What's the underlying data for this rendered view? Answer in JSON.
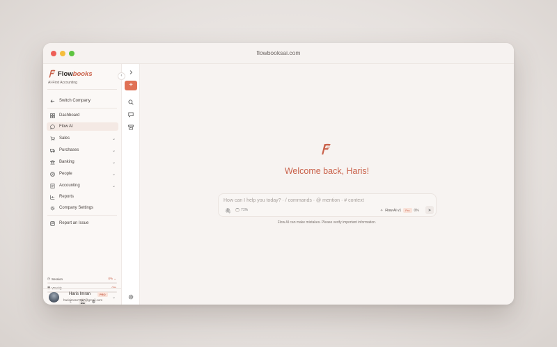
{
  "window": {
    "url": "flowbooksai.com"
  },
  "brand": {
    "name_plain": "Flow",
    "name_italic": "books",
    "tagline": "AI-First Accounting"
  },
  "sidebar": {
    "switch_company": "Switch Company",
    "items": [
      {
        "label": "Dashboard",
        "icon": "dashboard-icon"
      },
      {
        "label": "Flow AI",
        "icon": "chat-icon",
        "active": true
      },
      {
        "label": "Sales",
        "icon": "cart-icon",
        "expandable": true
      },
      {
        "label": "Purchases",
        "icon": "truck-icon",
        "expandable": true
      },
      {
        "label": "Banking",
        "icon": "bank-icon",
        "expandable": true
      },
      {
        "label": "People",
        "icon": "user-circle-icon",
        "expandable": true
      },
      {
        "label": "Accounting",
        "icon": "ledger-icon",
        "expandable": true
      },
      {
        "label": "Reports",
        "icon": "chart-icon"
      },
      {
        "label": "Company Settings",
        "icon": "gear-icon"
      }
    ],
    "report_issue": "Report an Issue",
    "usage": {
      "session": {
        "label": "Session",
        "value": "0%",
        "fill": 0
      },
      "weekly": {
        "label": "Weekly",
        "value": "0%",
        "fill": 0
      }
    }
  },
  "user": {
    "name": "Haris Imran",
    "badge": "PRO",
    "email": "harisimran7657@gmail.com"
  },
  "main": {
    "welcome": "Welcome back, Haris!",
    "chat": {
      "placeholder": "How can I help you today?  ·  / commands  ·  @ mention  ·  # context",
      "context_pct": "71%",
      "model": "Flow AI v1",
      "model_badge": "Pro",
      "model_pct": "0%"
    },
    "disclaimer": "Flow AI can make mistakes. Please verify important information."
  },
  "colors": {
    "accent": "#c9614a",
    "button": "#e07155"
  }
}
